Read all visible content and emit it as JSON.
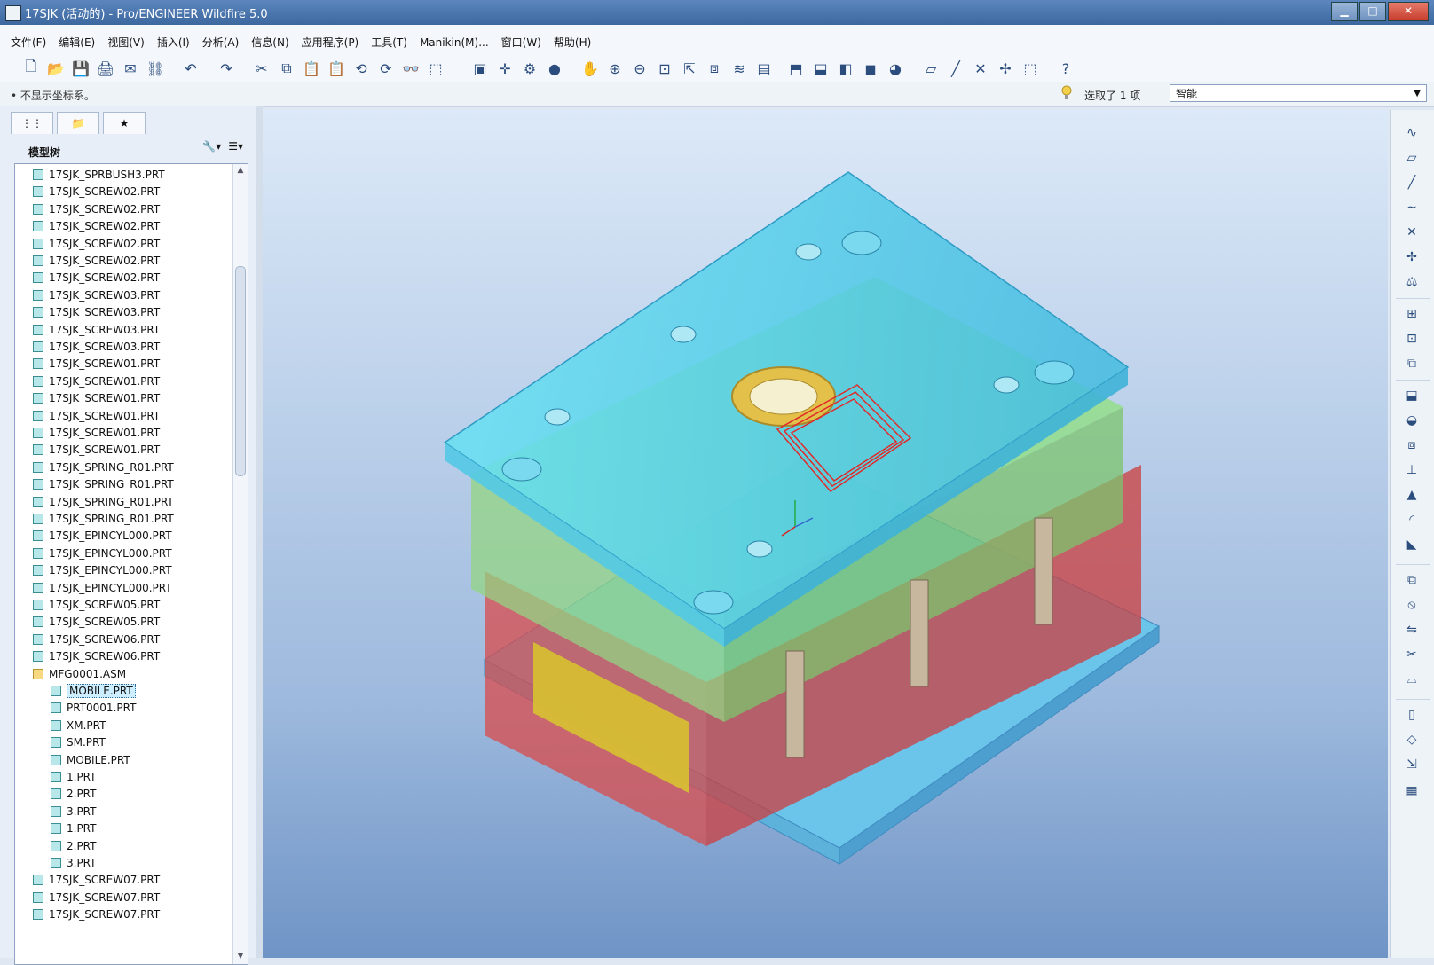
{
  "window": {
    "title": "17SJK (活动的) - Pro/ENGINEER Wildfire 5.0",
    "min_icon": "minimize-icon",
    "max_icon": "maximize-icon",
    "close_icon": "close-icon"
  },
  "menubar": [
    "文件(F)",
    "编辑(E)",
    "视图(V)",
    "插入(I)",
    "分析(A)",
    "信息(N)",
    "应用程序(P)",
    "工具(T)",
    "Manikin(M)...",
    "窗口(W)",
    "帮助(H)"
  ],
  "status": {
    "message": "• 不显示坐标系。",
    "selection": "选取了 1 项",
    "filter_value": "智能"
  },
  "left_panel": {
    "tree_title": "模型树",
    "tree": [
      {
        "label": "17SJK_SPRBUSH3.PRT",
        "level": 1
      },
      {
        "label": "17SJK_SCREW02.PRT",
        "level": 1
      },
      {
        "label": "17SJK_SCREW02.PRT",
        "level": 1
      },
      {
        "label": "17SJK_SCREW02.PRT",
        "level": 1
      },
      {
        "label": "17SJK_SCREW02.PRT",
        "level": 1
      },
      {
        "label": "17SJK_SCREW02.PRT",
        "level": 1
      },
      {
        "label": "17SJK_SCREW02.PRT",
        "level": 1
      },
      {
        "label": "17SJK_SCREW03.PRT",
        "level": 1
      },
      {
        "label": "17SJK_SCREW03.PRT",
        "level": 1
      },
      {
        "label": "17SJK_SCREW03.PRT",
        "level": 1
      },
      {
        "label": "17SJK_SCREW03.PRT",
        "level": 1
      },
      {
        "label": "17SJK_SCREW01.PRT",
        "level": 1
      },
      {
        "label": "17SJK_SCREW01.PRT",
        "level": 1
      },
      {
        "label": "17SJK_SCREW01.PRT",
        "level": 1
      },
      {
        "label": "17SJK_SCREW01.PRT",
        "level": 1
      },
      {
        "label": "17SJK_SCREW01.PRT",
        "level": 1
      },
      {
        "label": "17SJK_SCREW01.PRT",
        "level": 1
      },
      {
        "label": "17SJK_SPRING_R01.PRT",
        "level": 1
      },
      {
        "label": "17SJK_SPRING_R01.PRT",
        "level": 1
      },
      {
        "label": "17SJK_SPRING_R01.PRT",
        "level": 1
      },
      {
        "label": "17SJK_SPRING_R01.PRT",
        "level": 1
      },
      {
        "label": "17SJK_EPINCYL000.PRT",
        "level": 1
      },
      {
        "label": "17SJK_EPINCYL000.PRT",
        "level": 1
      },
      {
        "label": "17SJK_EPINCYL000.PRT",
        "level": 1
      },
      {
        "label": "17SJK_EPINCYL000.PRT",
        "level": 1
      },
      {
        "label": "17SJK_SCREW05.PRT",
        "level": 1
      },
      {
        "label": "17SJK_SCREW05.PRT",
        "level": 1
      },
      {
        "label": "17SJK_SCREW06.PRT",
        "level": 1
      },
      {
        "label": "17SJK_SCREW06.PRT",
        "level": 1
      },
      {
        "label": "MFG0001.ASM",
        "level": 1,
        "asm": true
      },
      {
        "label": "MOBILE.PRT",
        "level": 2,
        "selected": true
      },
      {
        "label": "PRT0001.PRT",
        "level": 2
      },
      {
        "label": "XM.PRT",
        "level": 2
      },
      {
        "label": "SM.PRT",
        "level": 2
      },
      {
        "label": "MOBILE.PRT",
        "level": 2
      },
      {
        "label": "1.PRT",
        "level": 2
      },
      {
        "label": "2.PRT",
        "level": 2
      },
      {
        "label": "3.PRT",
        "level": 2
      },
      {
        "label": "1.PRT",
        "level": 2
      },
      {
        "label": "2.PRT",
        "level": 2
      },
      {
        "label": "3.PRT",
        "level": 2
      },
      {
        "label": "17SJK_SCREW07.PRT",
        "level": 1
      },
      {
        "label": "17SJK_SCREW07.PRT",
        "level": 1
      },
      {
        "label": "17SJK_SCREW07.PRT",
        "level": 1
      }
    ]
  },
  "colors": {
    "blue_plate": "#62d8ef",
    "green_plate": "#8ee07d",
    "red_plate": "#d84b4b",
    "yellow_plate": "#d7c230",
    "viewport_top": "#dce9f8",
    "viewport_bottom": "#6f94c6"
  }
}
